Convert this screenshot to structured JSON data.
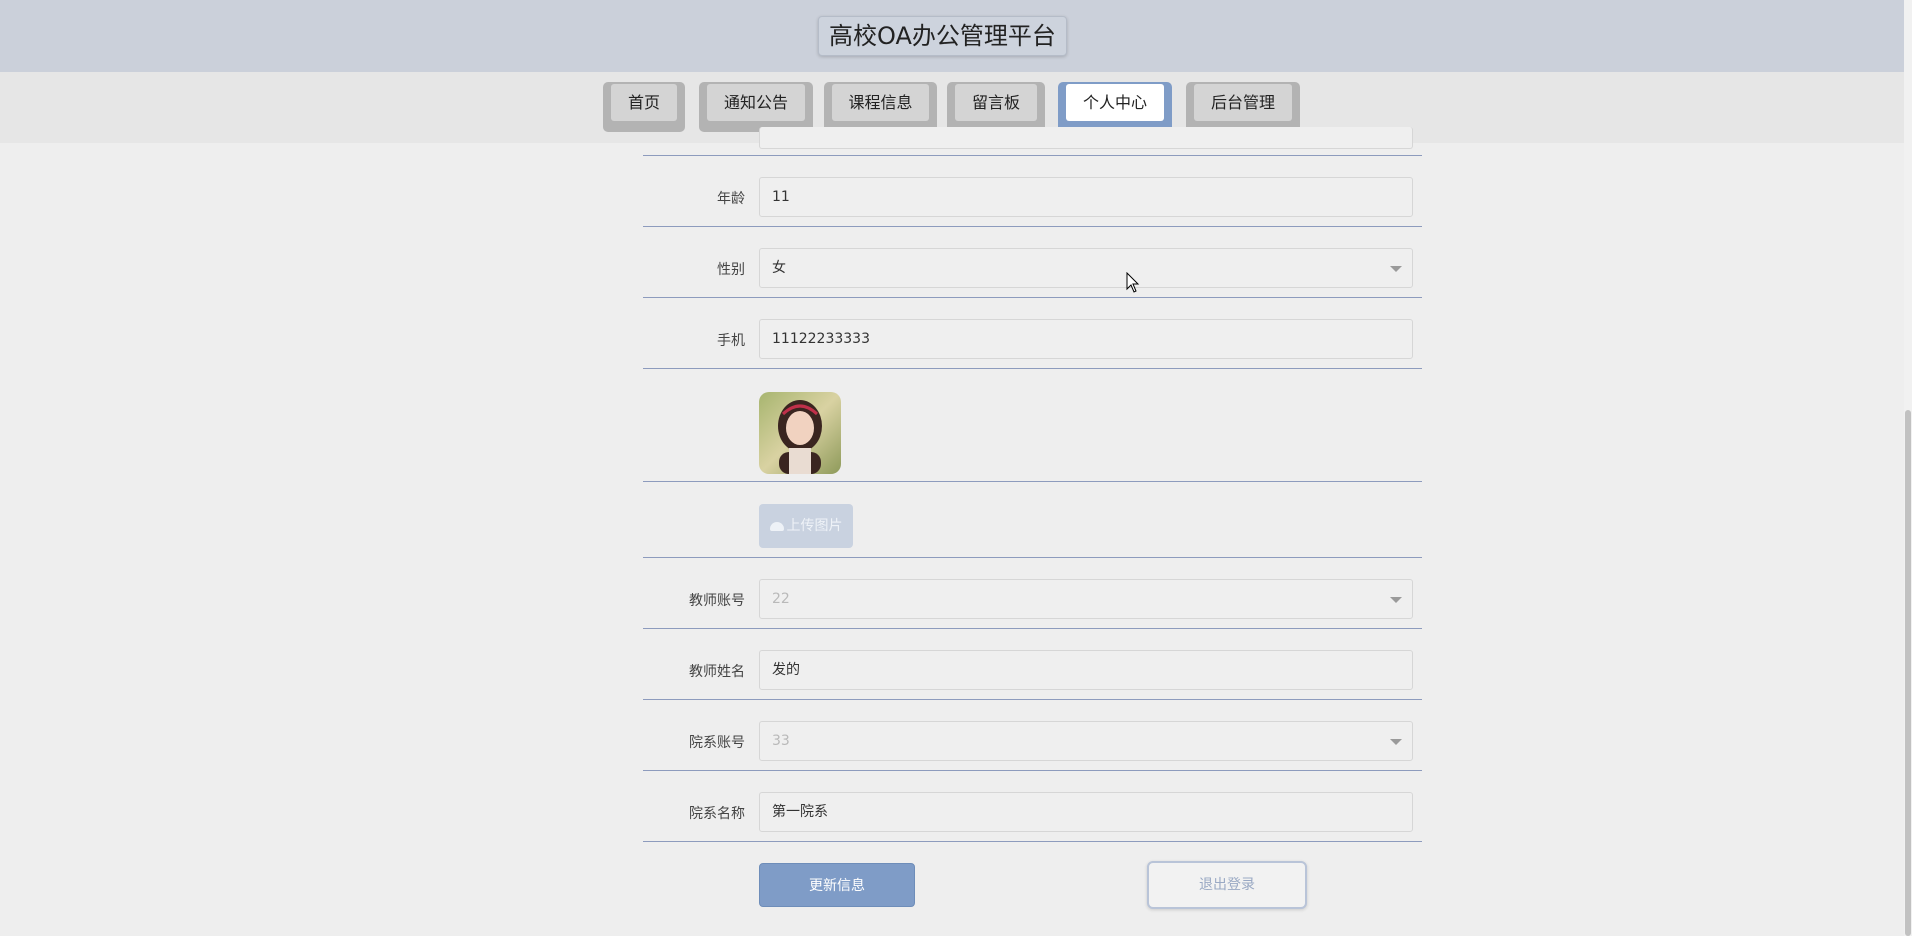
{
  "header": {
    "title": "高校OA办公管理平台"
  },
  "nav": {
    "items": [
      {
        "label": "首页"
      },
      {
        "label": "通知公告"
      },
      {
        "label": "课程信息"
      },
      {
        "label": "留言板"
      },
      {
        "label": "个人中心",
        "active": true
      },
      {
        "label": "后台管理"
      }
    ]
  },
  "form": {
    "age": {
      "label": "年龄",
      "value": "11"
    },
    "gender": {
      "label": "性别",
      "value": "女"
    },
    "phone": {
      "label": "手机",
      "value": "11122233333"
    },
    "avatar": {
      "icon": "avatar-photo"
    },
    "upload": {
      "label": "上传图片",
      "icon": "cloud-upload-icon"
    },
    "teacher_account": {
      "label": "教师账号",
      "value": "22"
    },
    "teacher_name": {
      "label": "教师姓名",
      "value": "发的"
    },
    "dept_account": {
      "label": "院系账号",
      "value": "33"
    },
    "dept_name": {
      "label": "院系名称",
      "value": "第一院系"
    }
  },
  "actions": {
    "update_label": "更新信息",
    "logout_label": "退出登录"
  },
  "colors": {
    "header_bg": "#cbd0da",
    "accent": "#7f9cc7",
    "nav_tab": "#b3b3b3",
    "row_line": "#8d9bbd"
  }
}
